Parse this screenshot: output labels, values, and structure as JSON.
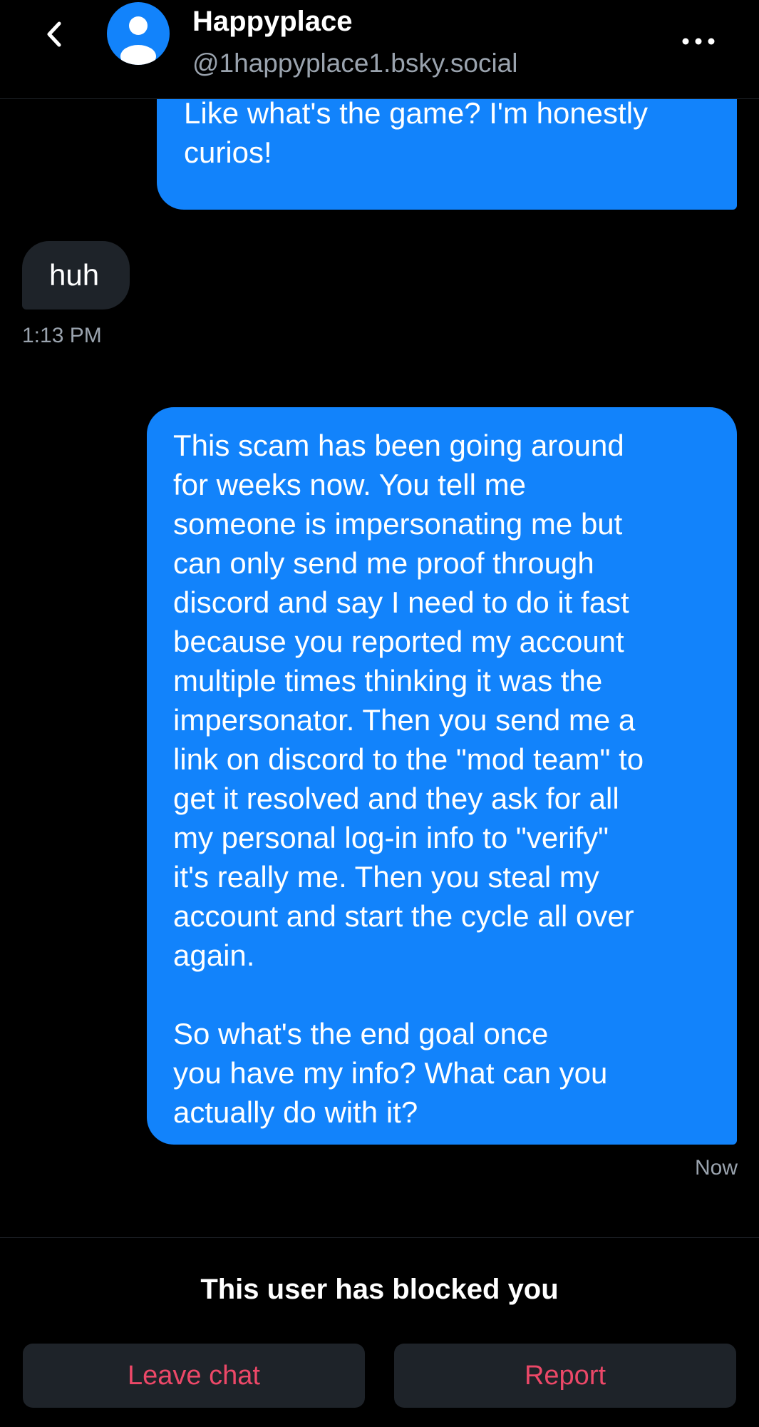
{
  "header": {
    "title": "Happyplace",
    "handle": "@1happyplace1.bsky.social",
    "back_icon": "chevron-left-icon",
    "avatar_icon": "default-user-avatar-icon",
    "more_icon": "more-horizontal-icon"
  },
  "messages": [
    {
      "sender": "me",
      "text": "info to get at my bank account?\nLike what's the game? I'm honestly\ncurios!"
    },
    {
      "sender": "them",
      "text": "huh",
      "time": "1:13 PM"
    },
    {
      "sender": "me",
      "text": "This scam has been going around\nfor weeks now. You tell me\nsomeone is impersonating me but\ncan only send me proof through\ndiscord and say I need to do it fast\nbecause you reported my account\nmultiple times thinking it was the\nimpersonator. Then you send me a\nlink on discord to the \"mod team\" to\nget it resolved and they ask for all\nmy personal log-in info to \"verify\"\nit's really me. Then you steal my\naccount and start the cycle all over\nagain.\n\nSo what's the end goal once\nyou have my info? What can you\nactually do with it?",
      "time": "Now"
    }
  ],
  "footer": {
    "blocked_text": "This user has blocked you",
    "leave_label": "Leave chat",
    "report_label": "Report"
  },
  "colors": {
    "background": "#000000",
    "my_bubble": "#1283fb",
    "their_bubble": "#1e2329",
    "muted_text": "#9aa3ae",
    "danger_text": "#ec4868"
  }
}
